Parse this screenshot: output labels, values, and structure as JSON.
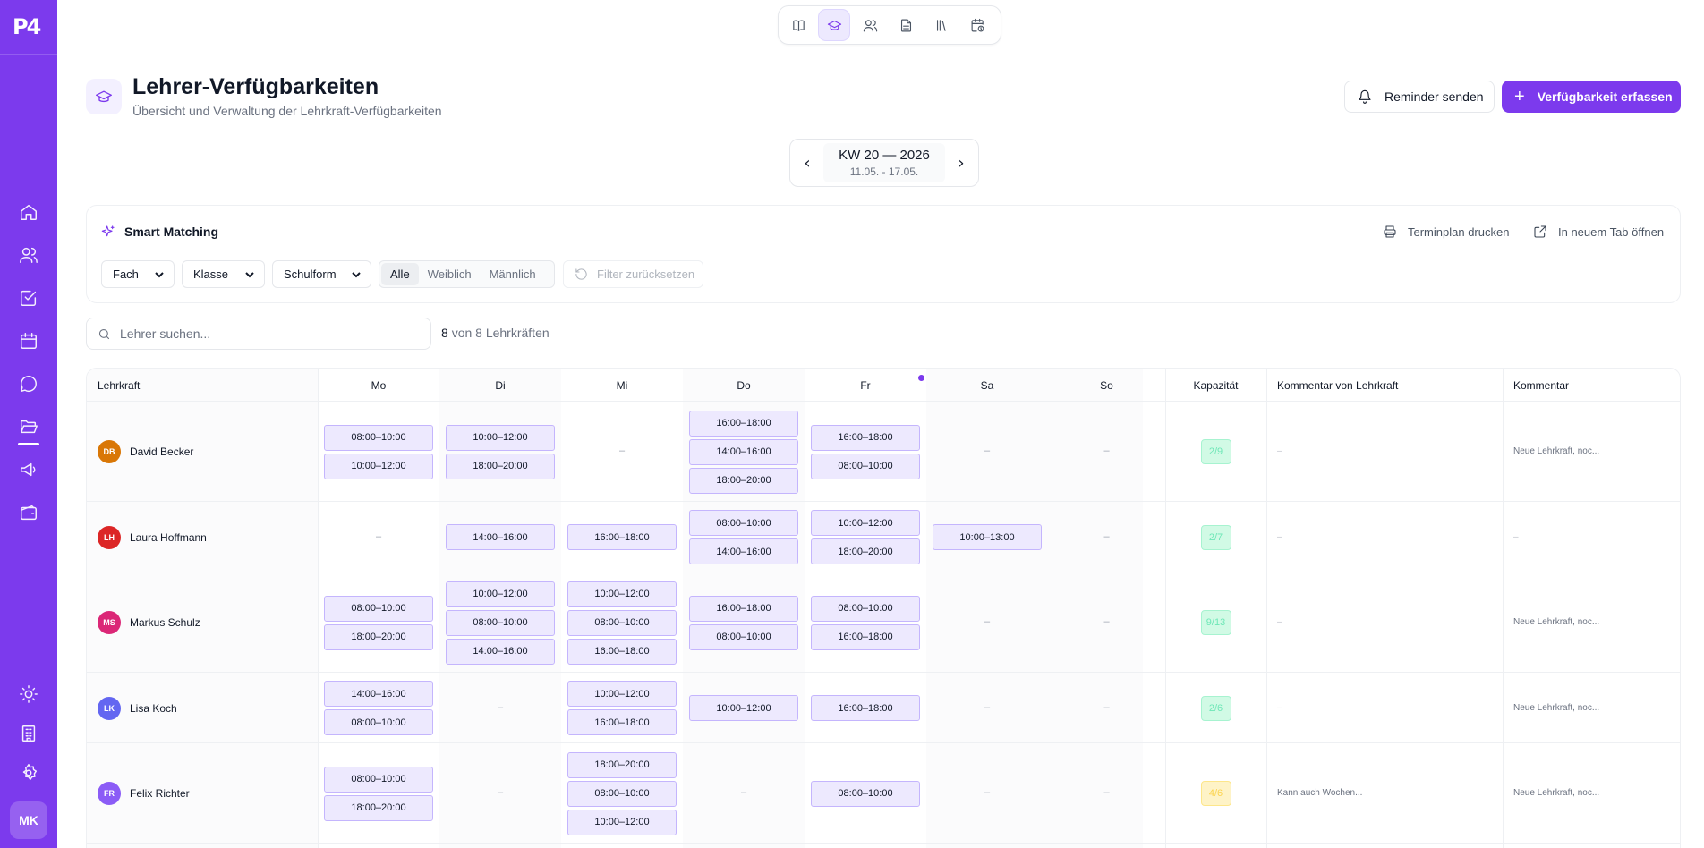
{
  "sidebar": {
    "logo": "P4",
    "user_initials": "MK",
    "items": [
      {
        "icon": "home-icon"
      },
      {
        "icon": "users-icon"
      },
      {
        "icon": "checklist-icon"
      },
      {
        "icon": "calendar-icon"
      },
      {
        "icon": "chat-icon"
      },
      {
        "icon": "folder-open-icon",
        "active": true
      },
      {
        "icon": "megaphone-icon"
      },
      {
        "icon": "wallet-icon"
      }
    ],
    "bottom_items": [
      {
        "icon": "sun-icon"
      },
      {
        "icon": "building-icon"
      },
      {
        "icon": "gear-icon"
      }
    ]
  },
  "topnav": {
    "items": [
      {
        "icon": "book-icon"
      },
      {
        "icon": "graduation-cap-icon",
        "active": true
      },
      {
        "icon": "users-icon"
      },
      {
        "icon": "document-icon"
      },
      {
        "icon": "library-icon"
      },
      {
        "icon": "calendar-clock-icon"
      }
    ]
  },
  "header": {
    "title": "Lehrer-Verfügbarkeiten",
    "subtitle": "Übersicht und Verwaltung der Lehrkraft-Verfügbarkeiten",
    "reminder_label": "Reminder senden",
    "primary_label": "Verfügbarkeit erfassen"
  },
  "week": {
    "label": "KW 20 — 2026",
    "range": "11.05. - 17.05."
  },
  "matching": {
    "title": "Smart Matching",
    "print_label": "Terminplan drucken",
    "open_tab_label": "In neuem Tab öffnen",
    "filters": {
      "fach": "Fach",
      "klasse": "Klasse",
      "schulform": "Schulform"
    },
    "gender": [
      "Alle",
      "Weiblich",
      "Männlich"
    ],
    "gender_selected": "Alle",
    "reset_label": "Filter zurücksetzen"
  },
  "search": {
    "placeholder": "Lehrer suchen..."
  },
  "count": {
    "shown": "8",
    "suffix": "von 8 Lehrkräften"
  },
  "table": {
    "headers": {
      "teacher": "Lehrkraft",
      "days": [
        "Mo",
        "Di",
        "Mi",
        "Do",
        "Fr",
        "Sa",
        "So"
      ],
      "capacity": "Kapazität",
      "teacher_comment": "Kommentar von Lehrkraft",
      "comment": "Kommentar"
    },
    "empty": "–",
    "rows": [
      {
        "initials": "DB",
        "name": "David Becker",
        "color": "#d97706",
        "slots": [
          [
            "08:00–10:00",
            "10:00–12:00"
          ],
          [
            "10:00–12:00",
            "18:00–20:00"
          ],
          [],
          [
            "16:00–18:00",
            "14:00–16:00",
            "18:00–20:00"
          ],
          [
            "16:00–18:00",
            "08:00–10:00"
          ],
          [],
          []
        ],
        "capacity": "2/9",
        "capacity_status": "green",
        "teacher_comment": "–",
        "comment": "Neue Lehrkraft, noc..."
      },
      {
        "initials": "LH",
        "name": "Laura Hoffmann",
        "color": "#dc2626",
        "slots": [
          [],
          [
            "14:00–16:00"
          ],
          [
            "16:00–18:00"
          ],
          [
            "08:00–10:00",
            "14:00–16:00"
          ],
          [
            "10:00–12:00",
            "18:00–20:00"
          ],
          [
            "10:00–13:00"
          ],
          []
        ],
        "capacity": "2/7",
        "capacity_status": "green",
        "teacher_comment": "–",
        "comment": "–"
      },
      {
        "initials": "MS",
        "name": "Markus Schulz",
        "color": "#db2777",
        "slots": [
          [
            "08:00–10:00",
            "18:00–20:00"
          ],
          [
            "10:00–12:00",
            "08:00–10:00",
            "14:00–16:00"
          ],
          [
            "10:00–12:00",
            "08:00–10:00",
            "16:00–18:00"
          ],
          [
            "16:00–18:00",
            "08:00–10:00"
          ],
          [
            "08:00–10:00",
            "16:00–18:00"
          ],
          [],
          []
        ],
        "capacity": "9/13",
        "capacity_status": "green",
        "teacher_comment": "–",
        "comment": "Neue Lehrkraft, noc..."
      },
      {
        "initials": "LK",
        "name": "Lisa Koch",
        "color": "#6366f1",
        "slots": [
          [
            "14:00–16:00",
            "08:00–10:00"
          ],
          [],
          [
            "10:00–12:00",
            "16:00–18:00"
          ],
          [
            "10:00–12:00"
          ],
          [
            "16:00–18:00"
          ],
          [],
          []
        ],
        "capacity": "2/6",
        "capacity_status": "green",
        "teacher_comment": "–",
        "comment": "Neue Lehrkraft, noc..."
      },
      {
        "initials": "FR",
        "name": "Felix Richter",
        "color": "#8b5cf6",
        "slots": [
          [
            "08:00–10:00",
            "18:00–20:00"
          ],
          [],
          [
            "18:00–20:00",
            "08:00–10:00",
            "10:00–12:00"
          ],
          [],
          [
            "08:00–10:00"
          ],
          [],
          []
        ],
        "capacity": "4/6",
        "capacity_status": "amber",
        "teacher_comment": "Kann auch Wochen...",
        "comment": "Neue Lehrkraft, noc..."
      }
    ]
  }
}
